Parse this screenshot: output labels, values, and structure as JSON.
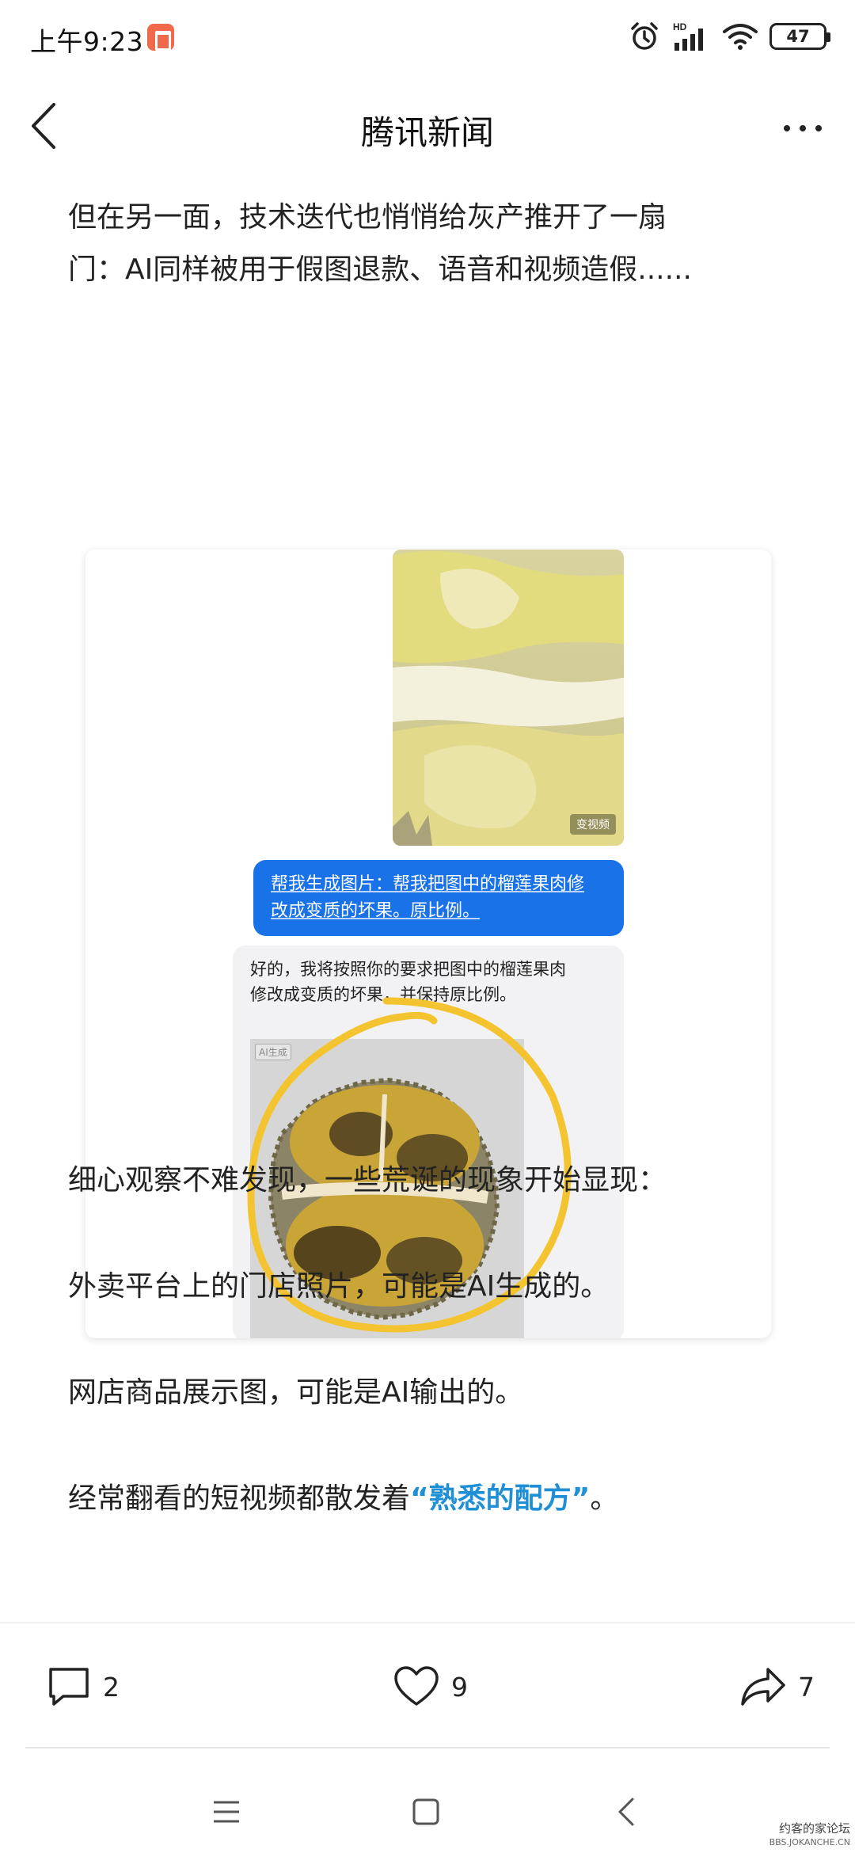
{
  "status_bar": {
    "time": "上午9:23",
    "network_label": "HD",
    "battery": "47"
  },
  "nav": {
    "title": "腾讯新闻"
  },
  "article": {
    "para_intro_1": "但在另一面，技术迭代也悄悄给灰产推开了一扇",
    "para_intro_2": "门：AI同样被用于假图退款、语音和视频造假......",
    "figure": {
      "video_badge": "变视频",
      "user_message_1": "帮我生成图片：帮我把图中的榴莲果肉修",
      "user_message_2": "改成变质的坏果。原比例。",
      "reply_1": "好的，我将按照你的要求把图中的榴莲果肉",
      "reply_2": "修改成变质的坏果，并保持原比例。",
      "ai_tag": "AI生成"
    },
    "para_observe": " 细心观察不难发现，一些荒诞的现象开始显现：",
    "para_1": "外卖平台上的门店照片，可能是AI生成的。",
    "para_2": "网店商品展示图，可能是AI输出的。",
    "para_3_prefix": "经常翻看的短视频都散发着",
    "para_3_highlight": "“熟悉的配方”",
    "para_3_suffix": "。"
  },
  "actions": {
    "comments": "2",
    "likes": "9",
    "shares": "7"
  },
  "watermark": {
    "line1": "约客的家论坛",
    "line2": "BBS.JOKANCHE.CN"
  },
  "colors": {
    "accent": "#1f8fd6",
    "user_bubble": "#1a72e8",
    "circle_highlight": "#f4c430"
  }
}
